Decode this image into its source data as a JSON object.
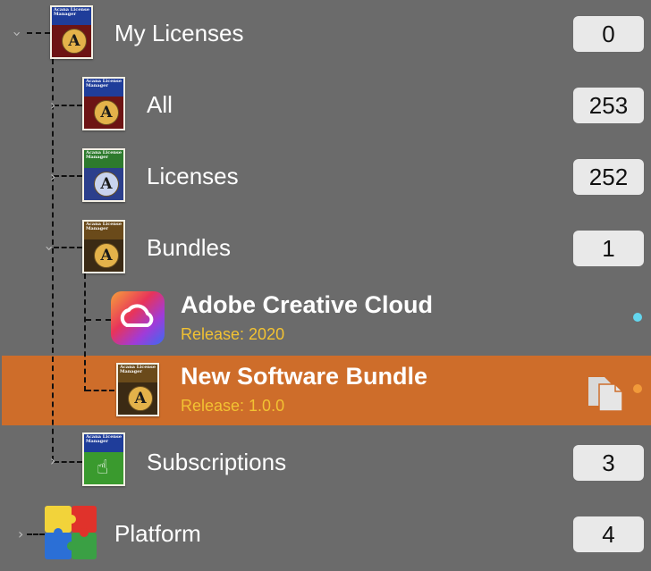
{
  "colors": {
    "background": "#6b6b6b",
    "selection": "#ce6d2a",
    "release_text": "#f2c232",
    "badge_bg": "#e9e9e9",
    "dot_cloud": "#63d6ee",
    "dot_bundle": "#f19a3a"
  },
  "icon_text": "Acana License Manager",
  "tree": {
    "my_licenses": {
      "label": "My Licenses",
      "count": "0",
      "icon": "license-manager-icon"
    },
    "all": {
      "label": "All",
      "count": "253",
      "icon": "license-manager-icon"
    },
    "licenses": {
      "label": "Licenses",
      "count": "252",
      "icon": "license-manager-icon"
    },
    "bundles": {
      "label": "Bundles",
      "count": "1",
      "icon": "license-manager-icon"
    },
    "adobe": {
      "title": "Adobe Creative Cloud",
      "release": "Release: 2020",
      "icon": "creative-cloud-icon"
    },
    "new_bundle": {
      "title": "New Software Bundle",
      "release": "Release: 1.0.0",
      "icon": "license-manager-icon",
      "action_icon": "duplicate-icon"
    },
    "subscriptions": {
      "label": "Subscriptions",
      "count": "3",
      "icon": "license-manager-icon"
    },
    "platform": {
      "label": "Platform",
      "count": "4",
      "icon": "puzzle-icon"
    }
  }
}
